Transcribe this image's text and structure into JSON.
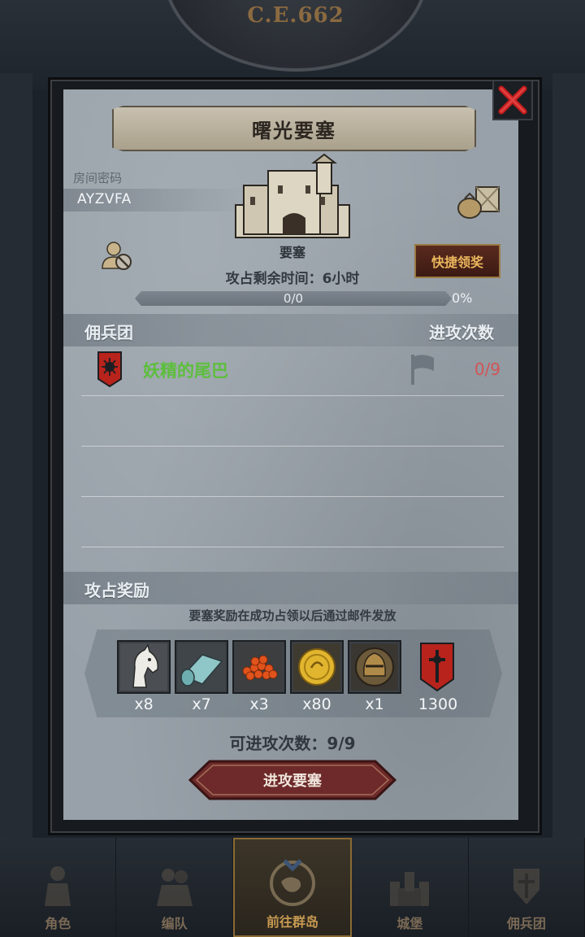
{
  "header": {
    "era": "C.E.662"
  },
  "modal": {
    "title": "曙光要塞",
    "room_label": "房间密码",
    "room_code": "AYZVFA",
    "building_label": "要塞",
    "quick_claim_label": "快捷领奖",
    "remaining_time": "攻占剩余时间：6小时",
    "progress": {
      "text": "0/0",
      "percent_label": "0%",
      "fraction": 0
    },
    "mercenary_header": "佣兵团",
    "attack_count_header": "进攻次数",
    "mercenaries": [
      {
        "name": "妖精的尾巴",
        "attacks": "0/9"
      }
    ],
    "reward_header": "攻占奖励",
    "reward_desc": "要塞奖励在成功占领以后通过邮件发放",
    "rewards": [
      {
        "icon": "horse-icon",
        "qty": "x8"
      },
      {
        "icon": "cloth-icon",
        "qty": "x7"
      },
      {
        "icon": "caviar-icon",
        "qty": "x3"
      },
      {
        "icon": "gold-coin-icon",
        "qty": "x80"
      },
      {
        "icon": "knight-helmet-icon",
        "qty": "x1"
      },
      {
        "icon": "guild-banner-icon",
        "qty": "1300"
      }
    ],
    "attack_times": "可进攻次数：9/9",
    "attack_button": "进攻要塞"
  },
  "bottom_nav": [
    {
      "label": "角色",
      "icon": "character-icon"
    },
    {
      "label": "编队",
      "icon": "formation-icon"
    },
    {
      "label": "前往群岛",
      "icon": "archipelago-icon"
    },
    {
      "label": "城堡",
      "icon": "castle-icon"
    },
    {
      "label": "佣兵团",
      "icon": "mercenary-icon"
    }
  ],
  "colors": {
    "panel": "#98a1a9",
    "accent_gold": "#c9a258",
    "merc_name": "#5cbf3c",
    "attack_count": "#d25555",
    "attack_button": "#6e2a2a"
  }
}
